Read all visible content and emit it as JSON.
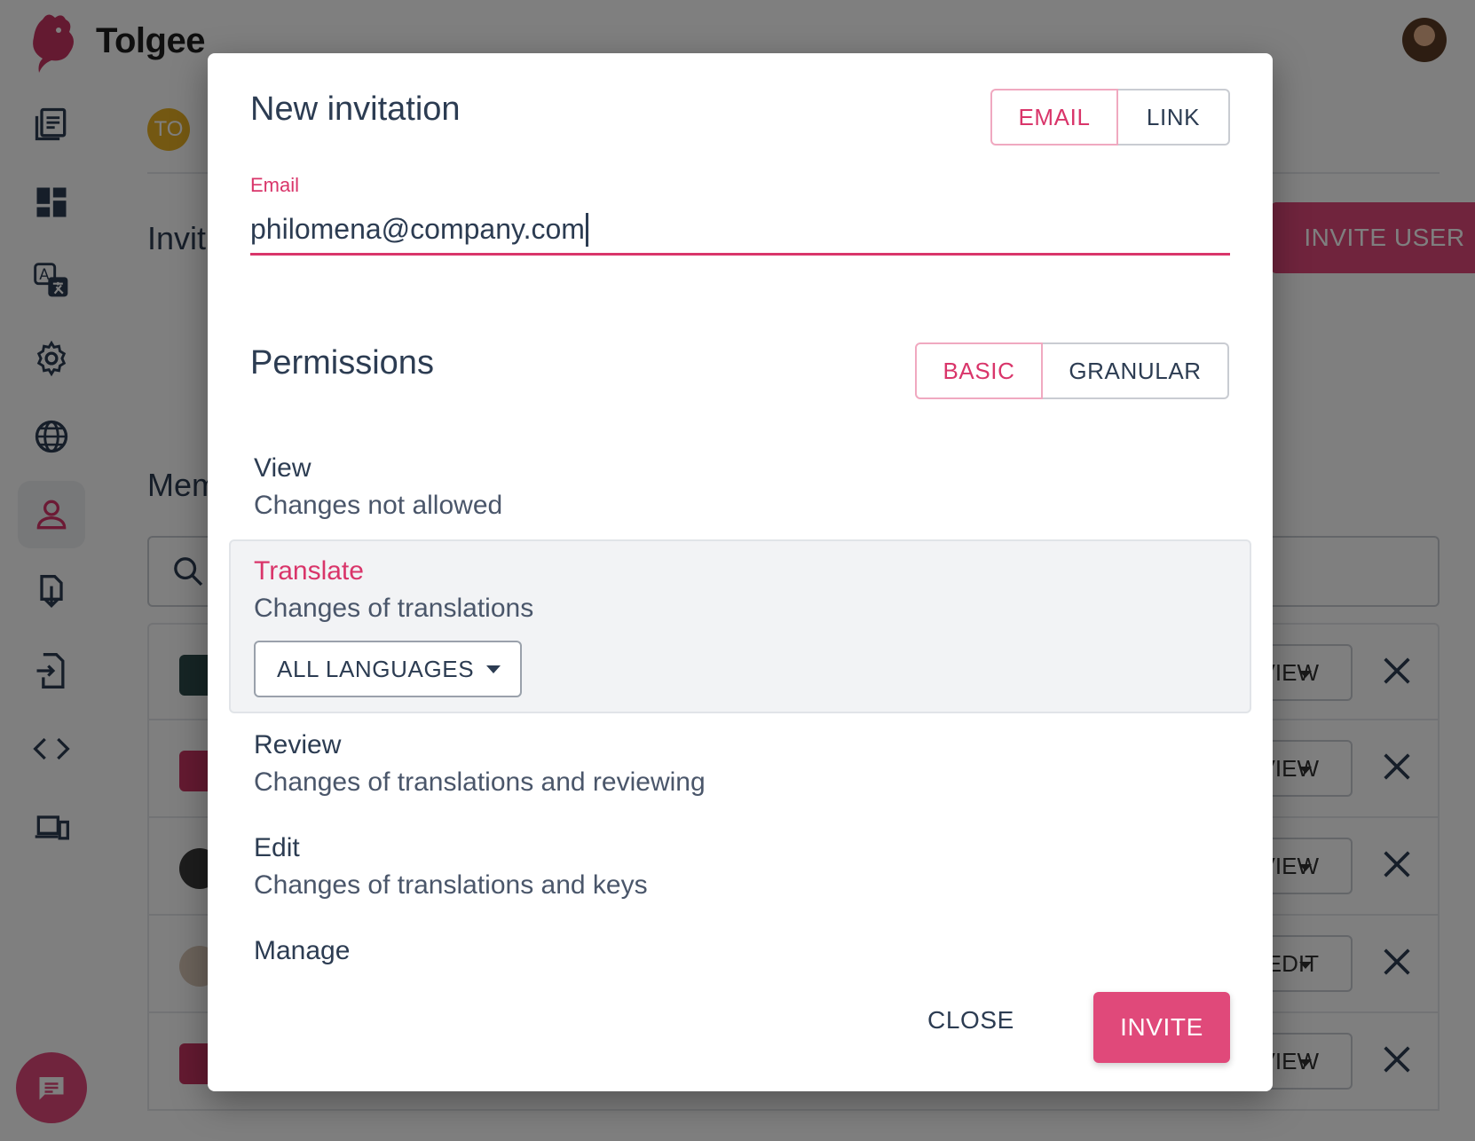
{
  "app": {
    "brand": "Tolgee",
    "project_initials": "TO",
    "section_invitations": "Invit",
    "section_members": "Mem",
    "invite_user_label": "INVITE USER",
    "member_rows": [
      {
        "role": "VIEW"
      },
      {
        "role": "VIEW"
      },
      {
        "role": "VIEW"
      },
      {
        "role": "EDIT"
      },
      {
        "role": "VIEW"
      }
    ]
  },
  "dialog": {
    "title": "New invitation",
    "mode_toggle": [
      {
        "label": "EMAIL",
        "selected": true
      },
      {
        "label": "LINK",
        "selected": false
      }
    ],
    "email": {
      "label": "Email",
      "value": "philomena@company.com"
    },
    "permissions_title": "Permissions",
    "permission_toggle": [
      {
        "label": "BASIC",
        "selected": true
      },
      {
        "label": "GRANULAR",
        "selected": false
      }
    ],
    "permissions": [
      {
        "name": "View",
        "description": "Changes not allowed"
      },
      {
        "name": "Translate",
        "description": "Changes of translations",
        "selected": true,
        "scope": "ALL LANGUAGES"
      },
      {
        "name": "Review",
        "description": "Changes of translations and reviewing"
      },
      {
        "name": "Edit",
        "description": "Changes of translations and keys"
      },
      {
        "name": "Manage",
        "description": ""
      }
    ],
    "close_label": "CLOSE",
    "invite_label": "INVITE"
  },
  "colors": {
    "accent": "#e0497a",
    "accent_text": "#d9356a",
    "text": "#2c3c52"
  }
}
